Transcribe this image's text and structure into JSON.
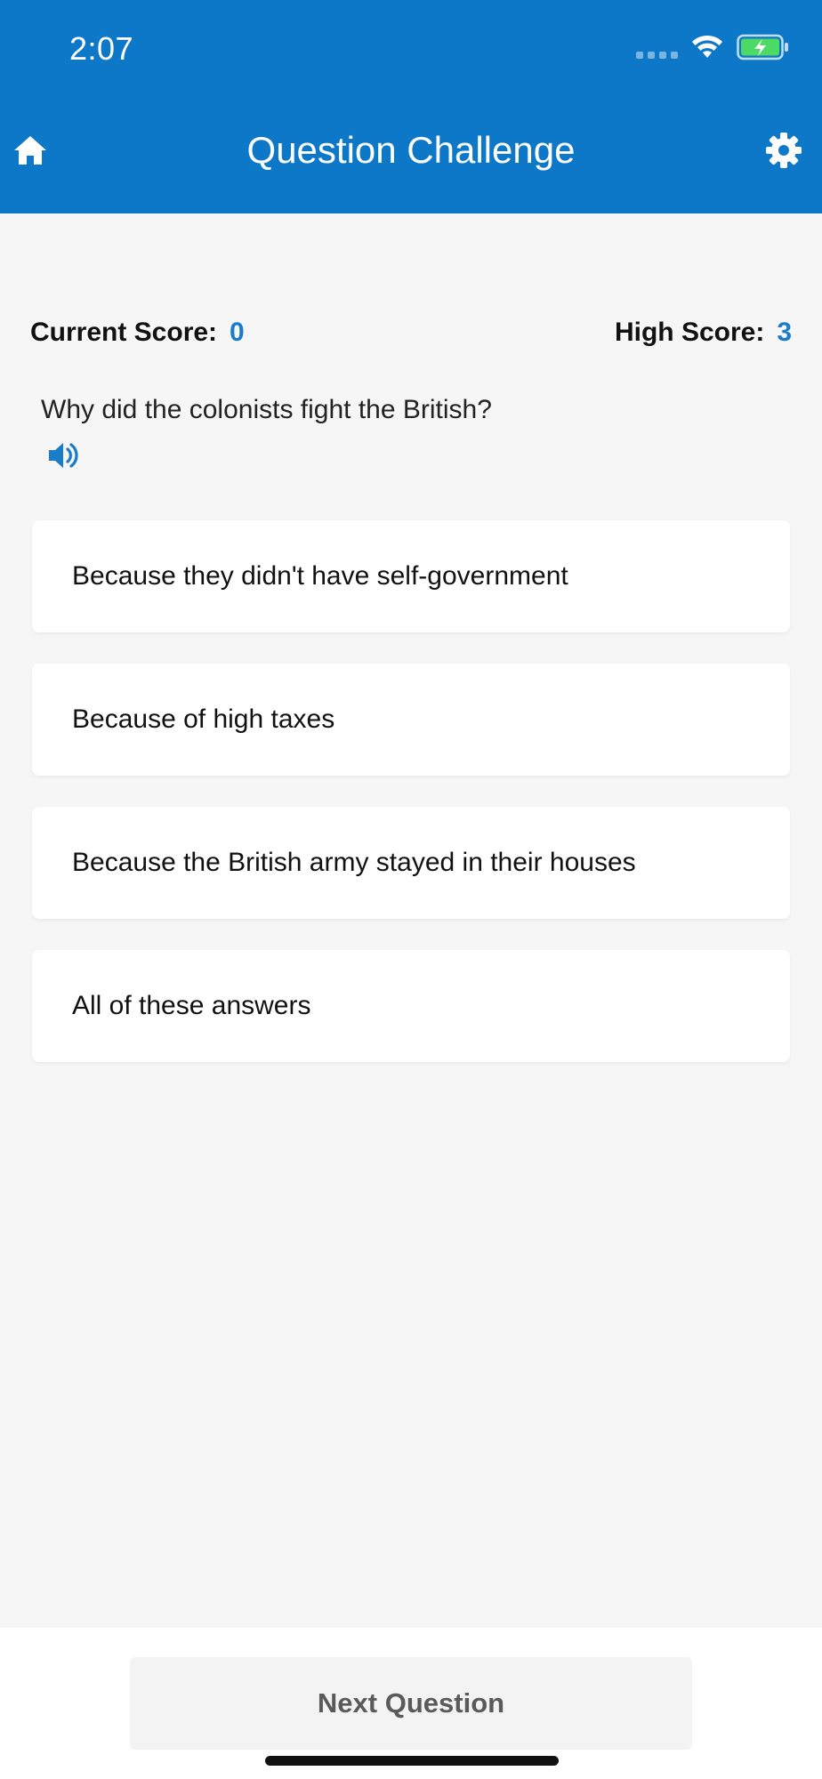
{
  "status_bar": {
    "time": "2:07"
  },
  "header": {
    "title": "Question Challenge",
    "home_icon": "home-icon",
    "settings_icon": "gear-icon"
  },
  "scores": {
    "current_label": "Current Score:",
    "current_value": "0",
    "high_label": "High Score:",
    "high_value": "3"
  },
  "question": {
    "text": "Why did the colonists fight the British?",
    "audio_icon": "speaker-icon"
  },
  "answers": [
    {
      "label": "Because they didn't have self-government"
    },
    {
      "label": "Because of high taxes"
    },
    {
      "label": "Because the British army stayed in their houses"
    },
    {
      "label": "All of these answers"
    }
  ],
  "footer": {
    "next_label": "Next Question"
  },
  "colors": {
    "header_bg": "#0e78c8",
    "accent": "#1a7cc9",
    "page_bg": "#f6f6f6",
    "battery_green": "#4cd964"
  }
}
